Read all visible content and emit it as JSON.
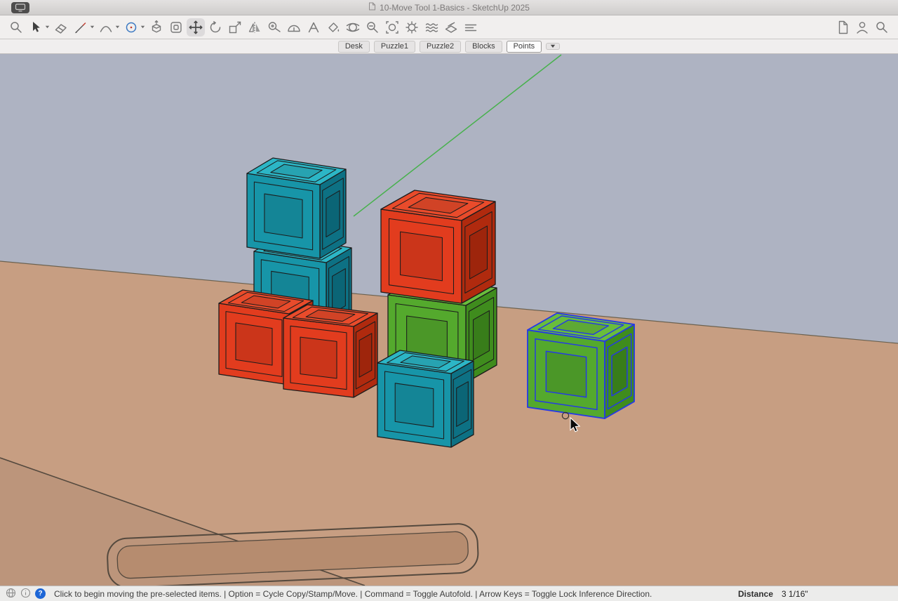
{
  "window": {
    "title": "10-Move Tool 1-Basics - SketchUp 2025"
  },
  "toolbar": {
    "tools": [
      "search-icon",
      "select-icon",
      "eraser-icon",
      "pencil-icon",
      "arc-icon",
      "circle-icon",
      "push-pull-icon",
      "offset-icon",
      "move-icon",
      "rotate-icon",
      "scale-icon",
      "flip-icon",
      "tape-measure-icon",
      "protractor-icon",
      "text-icon",
      "paint-bucket-icon",
      "orbit-icon",
      "zoom-icon",
      "zoom-extents-icon",
      "styles-icon",
      "shadows-icon",
      "section-plane-icon",
      "fog-icon"
    ],
    "dropdown_tools": [
      "select-icon",
      "pencil-icon",
      "arc-icon",
      "circle-icon"
    ],
    "selected_tool": "move-icon",
    "right_tools": [
      "document-panel-icon",
      "account-icon",
      "search-icon"
    ]
  },
  "scene_tabs": {
    "tabs": [
      "Desk",
      "Puzzle1",
      "Puzzle2",
      "Blocks",
      "Points"
    ],
    "active_tab": "Points",
    "overflow_icon": "chevron-down-icon"
  },
  "scene": {
    "cubes": [
      {
        "id": "teal-lower",
        "color": "teal",
        "selected": false
      },
      {
        "id": "teal-upper",
        "color": "teal",
        "selected": false
      },
      {
        "id": "red-left",
        "color": "red",
        "selected": false
      },
      {
        "id": "red-front",
        "color": "red",
        "selected": false
      },
      {
        "id": "green-middle",
        "color": "green",
        "selected": false
      },
      {
        "id": "red-top-middle",
        "color": "red",
        "selected": false
      },
      {
        "id": "teal-bottom",
        "color": "teal",
        "selected": false
      },
      {
        "id": "green-selected",
        "color": "green",
        "selected": true
      }
    ],
    "colors": {
      "sky": "#aeb3c2",
      "ground": "#c79e82",
      "horizon_line": "#6b614f",
      "desk_line": "#54493e",
      "desk_groove": "#b68c6f",
      "inference_line": "#47b14c",
      "teal_front": "#1795a8",
      "teal_side": "#0d7184",
      "teal_top": "#2cb6c6",
      "red_front": "#e23c1e",
      "red_side": "#b02a0e",
      "red_top": "#e94b2b",
      "green_front": "#54a92d",
      "green_side": "#3f8c1d",
      "green_top": "#69bd3c",
      "selection": "#2438e8"
    }
  },
  "status_bar": {
    "help_glyph": "?",
    "message": "Click to begin moving the pre-selected items. | Option = Cycle Copy/Stamp/Move. | Command = Toggle Autofold. | Arrow Keys = Toggle Lock Inference Direction.",
    "distance_label": "Distance",
    "distance_value": "3 1/16\""
  }
}
